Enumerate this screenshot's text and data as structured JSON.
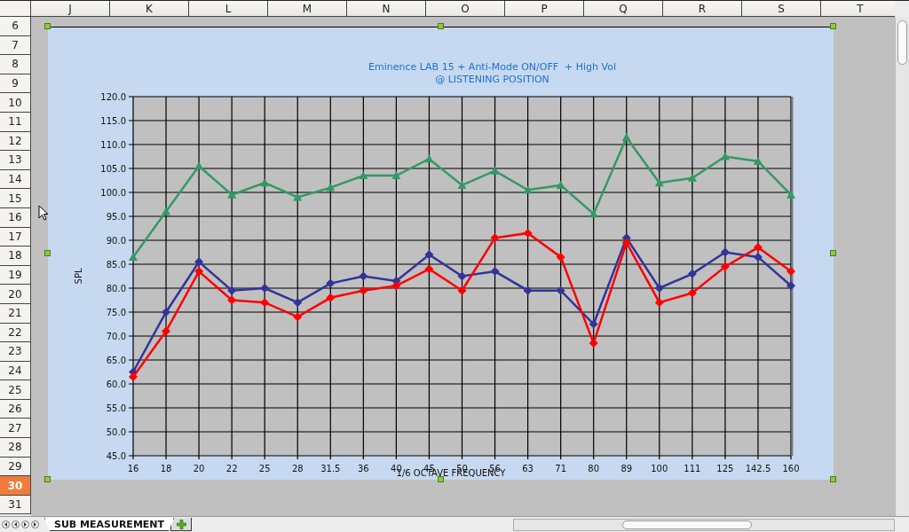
{
  "columns": [
    {
      "label": "J"
    },
    {
      "label": "K"
    },
    {
      "label": "L"
    },
    {
      "label": "M"
    },
    {
      "label": "N"
    },
    {
      "label": "O"
    },
    {
      "label": "P"
    },
    {
      "label": "Q"
    },
    {
      "label": "R"
    },
    {
      "label": "S"
    },
    {
      "label": "T"
    }
  ],
  "rows": [
    {
      "label": "6",
      "selected": false
    },
    {
      "label": "7",
      "selected": false
    },
    {
      "label": "8",
      "selected": false
    },
    {
      "label": "9",
      "selected": false
    },
    {
      "label": "10",
      "selected": false
    },
    {
      "label": "11",
      "selected": false
    },
    {
      "label": "12",
      "selected": false
    },
    {
      "label": "13",
      "selected": false
    },
    {
      "label": "14",
      "selected": false
    },
    {
      "label": "15",
      "selected": false
    },
    {
      "label": "16",
      "selected": false
    },
    {
      "label": "17",
      "selected": false
    },
    {
      "label": "18",
      "selected": false
    },
    {
      "label": "19",
      "selected": false
    },
    {
      "label": "20",
      "selected": false
    },
    {
      "label": "21",
      "selected": false
    },
    {
      "label": "22",
      "selected": false
    },
    {
      "label": "23",
      "selected": false
    },
    {
      "label": "24",
      "selected": false
    },
    {
      "label": "25",
      "selected": false
    },
    {
      "label": "26",
      "selected": false
    },
    {
      "label": "27",
      "selected": false
    },
    {
      "label": "28",
      "selected": false
    },
    {
      "label": "29",
      "selected": false
    },
    {
      "label": "30",
      "selected": true
    },
    {
      "label": "31",
      "selected": false
    }
  ],
  "chart": {
    "chart_data": {
      "type": "line",
      "title": "Eminence LAB 15 + Anti-Mode ON/OFF  + High Vol\n@ LISTENING POSITION",
      "xlabel": "1/6 OCTAVE FREQUENCY",
      "ylabel": "SPL",
      "categories": [
        "16",
        "18",
        "20",
        "22",
        "25",
        "28",
        "31.5",
        "36",
        "40",
        "45",
        "50",
        "56",
        "63",
        "71",
        "80",
        "89",
        "100",
        "111",
        "125",
        "142.5",
        "160"
      ],
      "ylim": [
        45,
        120
      ],
      "grid": true,
      "yticks": [
        {
          "value": 45,
          "label": "45.0"
        },
        {
          "value": 50,
          "label": "50.0"
        },
        {
          "value": 55,
          "label": "55.0"
        },
        {
          "value": 60,
          "label": "60.0"
        },
        {
          "value": 65,
          "label": "65.0"
        },
        {
          "value": 70,
          "label": "70.0"
        },
        {
          "value": 75,
          "label": "75.0"
        },
        {
          "value": 80,
          "label": "80.0"
        },
        {
          "value": 85,
          "label": "85.0"
        },
        {
          "value": 90,
          "label": "90.0"
        },
        {
          "value": 95,
          "label": "95.0"
        },
        {
          "value": 100,
          "label": "100.0"
        },
        {
          "value": 105,
          "label": "105.0"
        },
        {
          "value": 110,
          "label": "110.0"
        },
        {
          "value": 115,
          "label": "115.0"
        },
        {
          "value": 120,
          "label": "120.0"
        }
      ],
      "series": [
        {
          "color": "#339966",
          "marker": "triangle",
          "values": [
            86.5,
            96,
            105.5,
            99.5,
            102,
            99,
            101,
            103.5,
            103.5,
            107,
            101.5,
            104.5,
            100.5,
            101.5,
            95.5,
            111.5,
            102,
            103,
            107.5,
            106.5,
            99.5
          ]
        },
        {
          "color": "#333399",
          "marker": "diamond",
          "values": [
            62.5,
            75,
            85.5,
            79.5,
            80,
            77,
            81,
            82.5,
            81.5,
            87,
            82.5,
            83.5,
            79.5,
            79.5,
            72.5,
            90.5,
            80,
            83,
            87.5,
            86.5,
            80.5
          ]
        },
        {
          "color": "#ff0000",
          "marker": "diamond",
          "values": [
            61.5,
            71,
            83.5,
            77.5,
            77,
            74,
            78,
            79.5,
            80.5,
            84,
            79.5,
            90.5,
            91.5,
            86.5,
            68.5,
            89.5,
            77,
            79,
            84.5,
            88.5,
            83.5
          ]
        }
      ]
    }
  },
  "sheet_tabs": [
    {
      "label": "SUB MEASUREMENT",
      "selected": true
    }
  ]
}
